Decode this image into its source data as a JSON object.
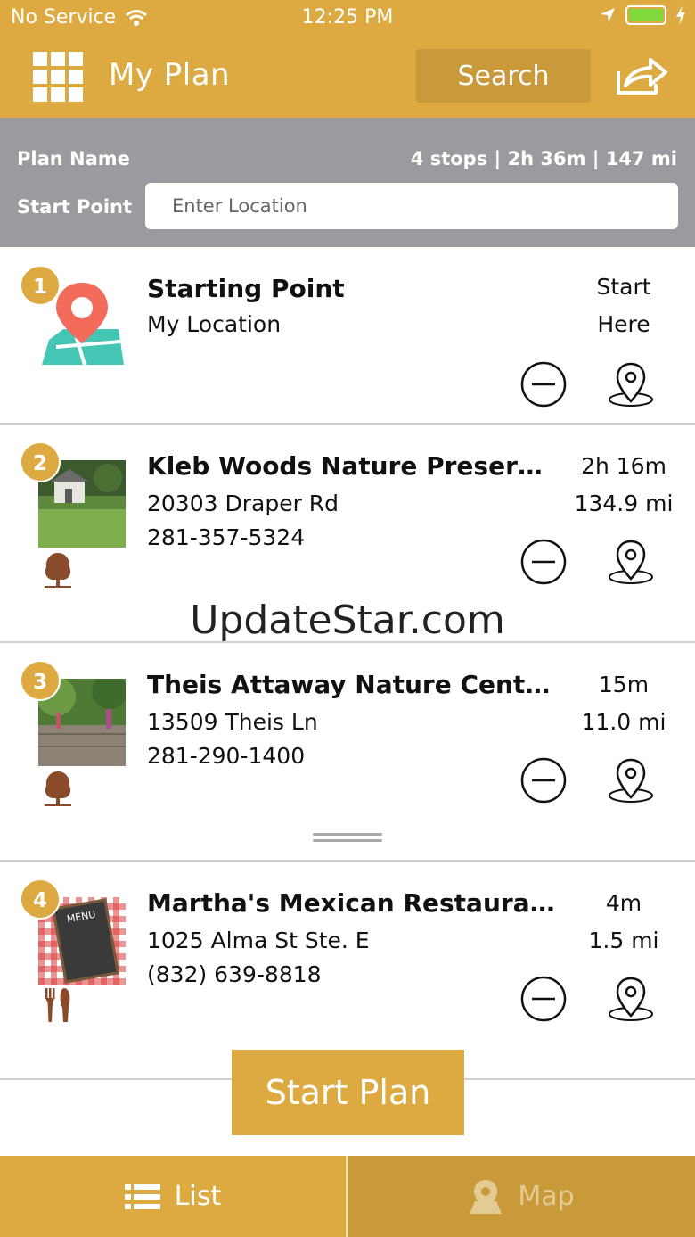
{
  "status": {
    "carrier": "No Service",
    "time": "12:25 PM"
  },
  "header": {
    "title": "My Plan",
    "search_label": "Search"
  },
  "plan": {
    "name_label": "Plan Name",
    "stats": "4 stops | 2h 36m | 147 mi",
    "start_label": "Start Point",
    "location_placeholder": "Enter Location"
  },
  "stops": [
    {
      "number": "1",
      "name": "Starting Point",
      "address": "My Location",
      "phone": "",
      "meta1": "Start",
      "meta2": "Here"
    },
    {
      "number": "2",
      "name": "Kleb Woods Nature Preserve...",
      "address": "20303 Draper Rd",
      "phone": "281-357-5324",
      "meta1": "2h 16m",
      "meta2": "134.9 mi"
    },
    {
      "number": "3",
      "name": "Theis Attaway Nature Center",
      "address": "13509 Theis Ln",
      "phone": "281-290-1400",
      "meta1": "15m",
      "meta2": "11.0 mi"
    },
    {
      "number": "4",
      "name": "Martha's Mexican Restaurant...",
      "address": "1025 Alma St Ste. E",
      "phone": "(832) 639-8818",
      "meta1": "4m",
      "meta2": "1.5 mi"
    }
  ],
  "menu_sign": "MENU",
  "watermark": "UpdateStar.com",
  "start_plan_label": "Start Plan",
  "tabs": {
    "list_label": "List",
    "map_label": "Map"
  },
  "colors": {
    "accent": "#dcaa40",
    "accent_dark": "#c9993a",
    "plan_bar": "#999b9f",
    "pin_red": "#f26b5b",
    "tree_brown": "#8a4b2a"
  }
}
